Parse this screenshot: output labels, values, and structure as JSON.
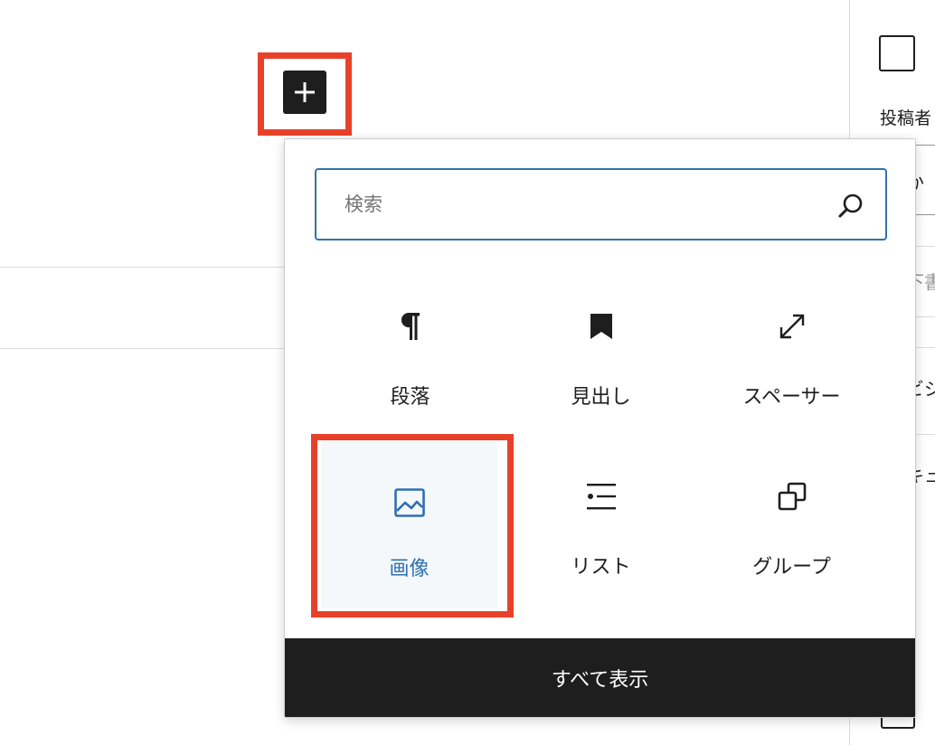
{
  "inserter": {
    "toggle_icon": "plus-icon",
    "search": {
      "placeholder": "検索",
      "value": "",
      "icon": "search-icon"
    },
    "blocks": [
      {
        "label": "段落",
        "icon": "paragraph-icon",
        "selected": false
      },
      {
        "label": "見出し",
        "icon": "bookmark-icon",
        "selected": false
      },
      {
        "label": "スペーサー",
        "icon": "resize-icon",
        "selected": false
      },
      {
        "label": "画像",
        "icon": "image-icon",
        "selected": true
      },
      {
        "label": "リスト",
        "icon": "list-icon",
        "selected": false
      },
      {
        "label": "グループ",
        "icon": "group-icon",
        "selected": false
      }
    ],
    "browse_all_label": "すべて表示"
  },
  "sidebar": {
    "author_label": "投稿者",
    "fragments": [
      "か",
      "下書",
      "ビジ",
      "キュ"
    ]
  },
  "colors": {
    "highlight": "#e8412a",
    "accent": "#2e6fb0",
    "dark": "#1e1e1e"
  }
}
